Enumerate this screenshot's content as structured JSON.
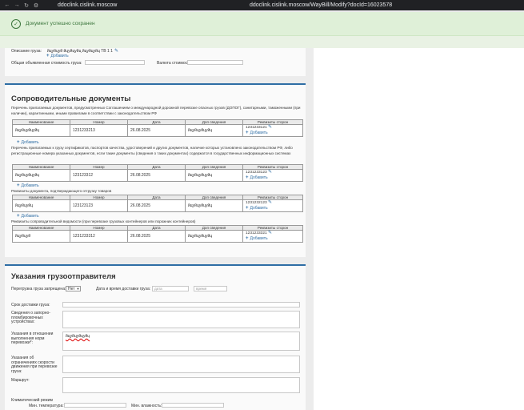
{
  "browser": {
    "host": "ddoclink.cislink.moscow",
    "url": "ddoclink.cislink.moscow/WayBill/Modify?docId=16023578"
  },
  "alert": {
    "text": "Документ успешно сохранен"
  },
  "cargo": {
    "desc_label": "Описание груза:",
    "desc_value": "йцуйцуй йцуйцуйц йцуйцуйц ТВ 1 1",
    "add_label": "Добавить",
    "value_label": "Общая объявленная стоимость груза:",
    "currency_label": "Валюта стоимости:"
  },
  "docs": {
    "title": "Сопроводительные документы",
    "columns": [
      "Наименование",
      "Номер",
      "Дата",
      "Доп сведения",
      "Реквизиты сторон"
    ],
    "add_label": "Добавить",
    "sections": [
      {
        "desc": "Перечень прилагаемых документов, предусмотренных Соглашением о международной дорожной перевозке опасных грузов (ДОПОГ), санитарными, таможенными (при наличии), карантинными, иными правилами в соответствии с законодательством РФ",
        "row": [
          "йцуйцуйцуйц",
          "1231233213",
          "26.08.2025",
          "йцуйцуйцуйц",
          "1231233121"
        ]
      },
      {
        "desc": "Перечень прилагаемых к грузу сертификатов, паспортов качества, удостоверений и других документов, наличие которых установлено законодательством РФ, либо регистрационные номера указанных документов, если такие документы (сведения о таких документах) содержатся в государственных информационных системах",
        "row": [
          "йцуйцуйцуйц",
          "123123312",
          "26.08.2025",
          "йцуйцуйцуйц",
          "1231233123"
        ]
      },
      {
        "desc": "Реквизиты документа, подтверждающего отгрузку товаров",
        "row": [
          "йцуйцуйц",
          "123123123",
          "26.08.2025",
          "йцуйцуйцуйц",
          "1231232123"
        ]
      },
      {
        "desc": "Реквизиты сопроводительной ведомости (при перевозке грузовых контейнеров или порожних контейнеров)",
        "row": [
          "йцуйцуй",
          "1231233312",
          "26.08.2025",
          "йцуйцуйцуйц",
          "1231233321"
        ]
      }
    ]
  },
  "shipper": {
    "title": "Указания грузоотправителя",
    "reload_label": "Перегрузка груза запрещена:",
    "reload_value": "Нет",
    "delivery_label": "Дата и время доставки груза:",
    "date_placeholder": "дата",
    "time_placeholder": "время",
    "term_label": "Срок доставки груза:",
    "locking_label": "Сведения о запорно-пломбировочных устройствах:",
    "mass_label": "Указания в отношении выполнения норм перевозки*:",
    "mass_value": "йцуйцуйцуйц",
    "speed_label": "Указания об ограничениях скорости движения при перевозке груза:",
    "route_label": "Маршрут:",
    "climate_label": "Климатический режим",
    "min_temp_label": "Мин. температура:",
    "min_hum_label": "Мин. влажность:"
  }
}
